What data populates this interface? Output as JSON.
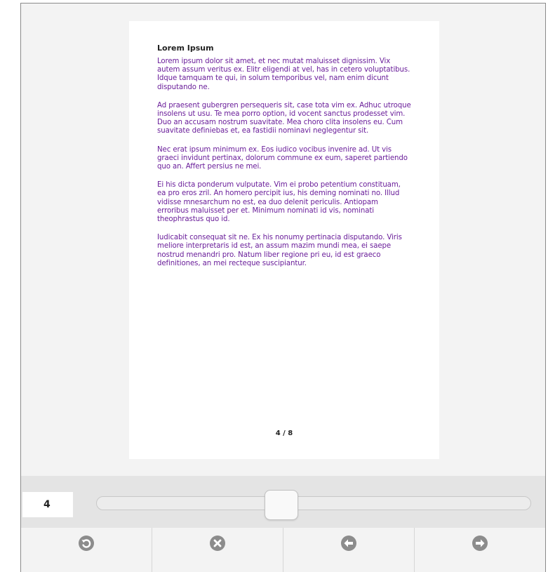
{
  "document": {
    "title": "Lorem Ipsum",
    "paragraphs": [
      "Lorem ipsum dolor sit amet, et nec mutat maluisset dignissim. Vix autem assum veritus ex. Elitr eligendi at vel, has in cetero voluptatibus. Idque tamquam te qui, in solum temporibus vel, nam enim dicunt disputando ne.",
      "Ad praesent gubergren persequeris sit, case tota vim ex. Adhuc utroque insolens ut usu. Te mea porro option, id vocent sanctus prodesset vim. Duo an accusam nostrum suavitate. Mea choro clita insolens eu. Cum suavitate definiebas et, ea fastidii nominavi neglegentur sit.",
      "Nec erat ipsum minimum ex. Eos iudico vocibus invenire ad. Ut vis graeci invidunt pertinax, dolorum commune ex eum, saperet partiendo quo an. Affert persius ne mei.",
      "Ei his dicta ponderum vulputate. Vim ei probo petentium constituam, ea pro eros zril. An homero percipit ius, his deming nominati no. Illud vidisse mnesarchum no est, ea duo delenit periculis. Antiopam erroribus maluisset per et. Minimum nominati id vis, nominati theophrastus quo id.",
      "Iudicabit consequat sit ne. Ex his nonumy pertinacia disputando. Viris meliore interpretaris id est, an assum mazim mundi mea, ei saepe nostrud menandri pro. Natum liber regione pri eu, id est graeco definitiones, an mei recteque suscipiantur."
    ],
    "page_indicator": "4 / 8"
  },
  "navigation": {
    "current_page": "4",
    "slider_value": 4,
    "total_pages": 8
  },
  "toolbar": {
    "buttons": [
      {
        "icon": "undo-icon"
      },
      {
        "icon": "close-icon"
      },
      {
        "icon": "arrow-left-icon"
      },
      {
        "icon": "arrow-right-icon"
      }
    ]
  },
  "colors": {
    "body_text": "#6a1e9a",
    "icon": "#8c8c8c"
  }
}
